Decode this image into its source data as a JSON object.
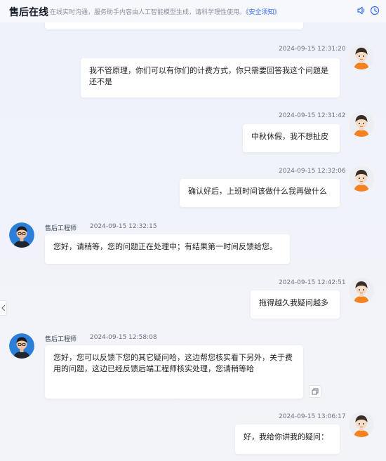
{
  "header": {
    "title": "售后在线",
    "notice": "在线实时沟通，服务助手内容由人工智能模型生成，请科学理性使用。",
    "notice_link": "《安全须知》"
  },
  "messages": [
    {
      "from": "user",
      "time": "2024-09-15 12:31:20",
      "text": "我不管原理，你们可以有你们的计费方式，你只需要回答我这个问题是还不是"
    },
    {
      "from": "user",
      "time": "2024-09-15 12:31:42",
      "text": "中秋休假，我不想扯皮"
    },
    {
      "from": "user",
      "time": "2024-09-15 12:32:06",
      "text": "确认好后，上班时间该做什么我再做什么"
    },
    {
      "from": "agent",
      "name": "售后工程师",
      "time": "2024-09-15 12:32:15",
      "text": "您好，请稍等，您的问题正在处理中；有结果第一时间反馈给您。"
    },
    {
      "from": "user",
      "time": "2024-09-15 12:42:51",
      "text": "拖得越久我疑问越多"
    },
    {
      "from": "agent",
      "name": "售后工程师",
      "time": "2024-09-15 12:58:08",
      "text": "您好，您可以反馈下您的其它疑问哈，这边帮您核实看下另外，关于费用的问题，这边已经反馈后端工程师核实处理，您请稍等哈"
    },
    {
      "from": "user",
      "time": "2024-09-15 13:06:17",
      "text": "好，我给你讲我的疑问："
    }
  ],
  "icons": {
    "speaker": "speaker-icon",
    "clock": "clock-icon",
    "copy": "copy-icon",
    "side_arrow": "chevron-left-icon"
  },
  "colors": {
    "link": "#2f6bff",
    "user_shirt": "#f58220",
    "agent_avatar_bg": "#2b7fd9"
  }
}
